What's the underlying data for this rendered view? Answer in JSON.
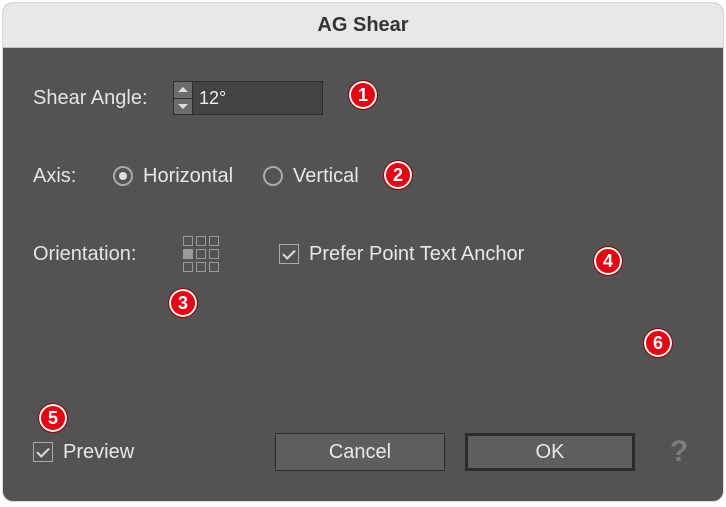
{
  "title": "AG Shear",
  "shear": {
    "label": "Shear Angle:",
    "value": "12°"
  },
  "axis": {
    "label": "Axis:",
    "options": [
      {
        "label": "Horizontal",
        "selected": true
      },
      {
        "label": "Vertical",
        "selected": false
      }
    ]
  },
  "orientation": {
    "label": "Orientation:",
    "selected_index": 3
  },
  "prefer_anchor": {
    "label": "Prefer Point Text Anchor",
    "checked": true
  },
  "preview": {
    "label": "Preview",
    "checked": true
  },
  "buttons": {
    "cancel": "Cancel",
    "ok": "OK"
  },
  "help_glyph": "?",
  "annotations": [
    "1",
    "2",
    "3",
    "4",
    "5",
    "6"
  ]
}
